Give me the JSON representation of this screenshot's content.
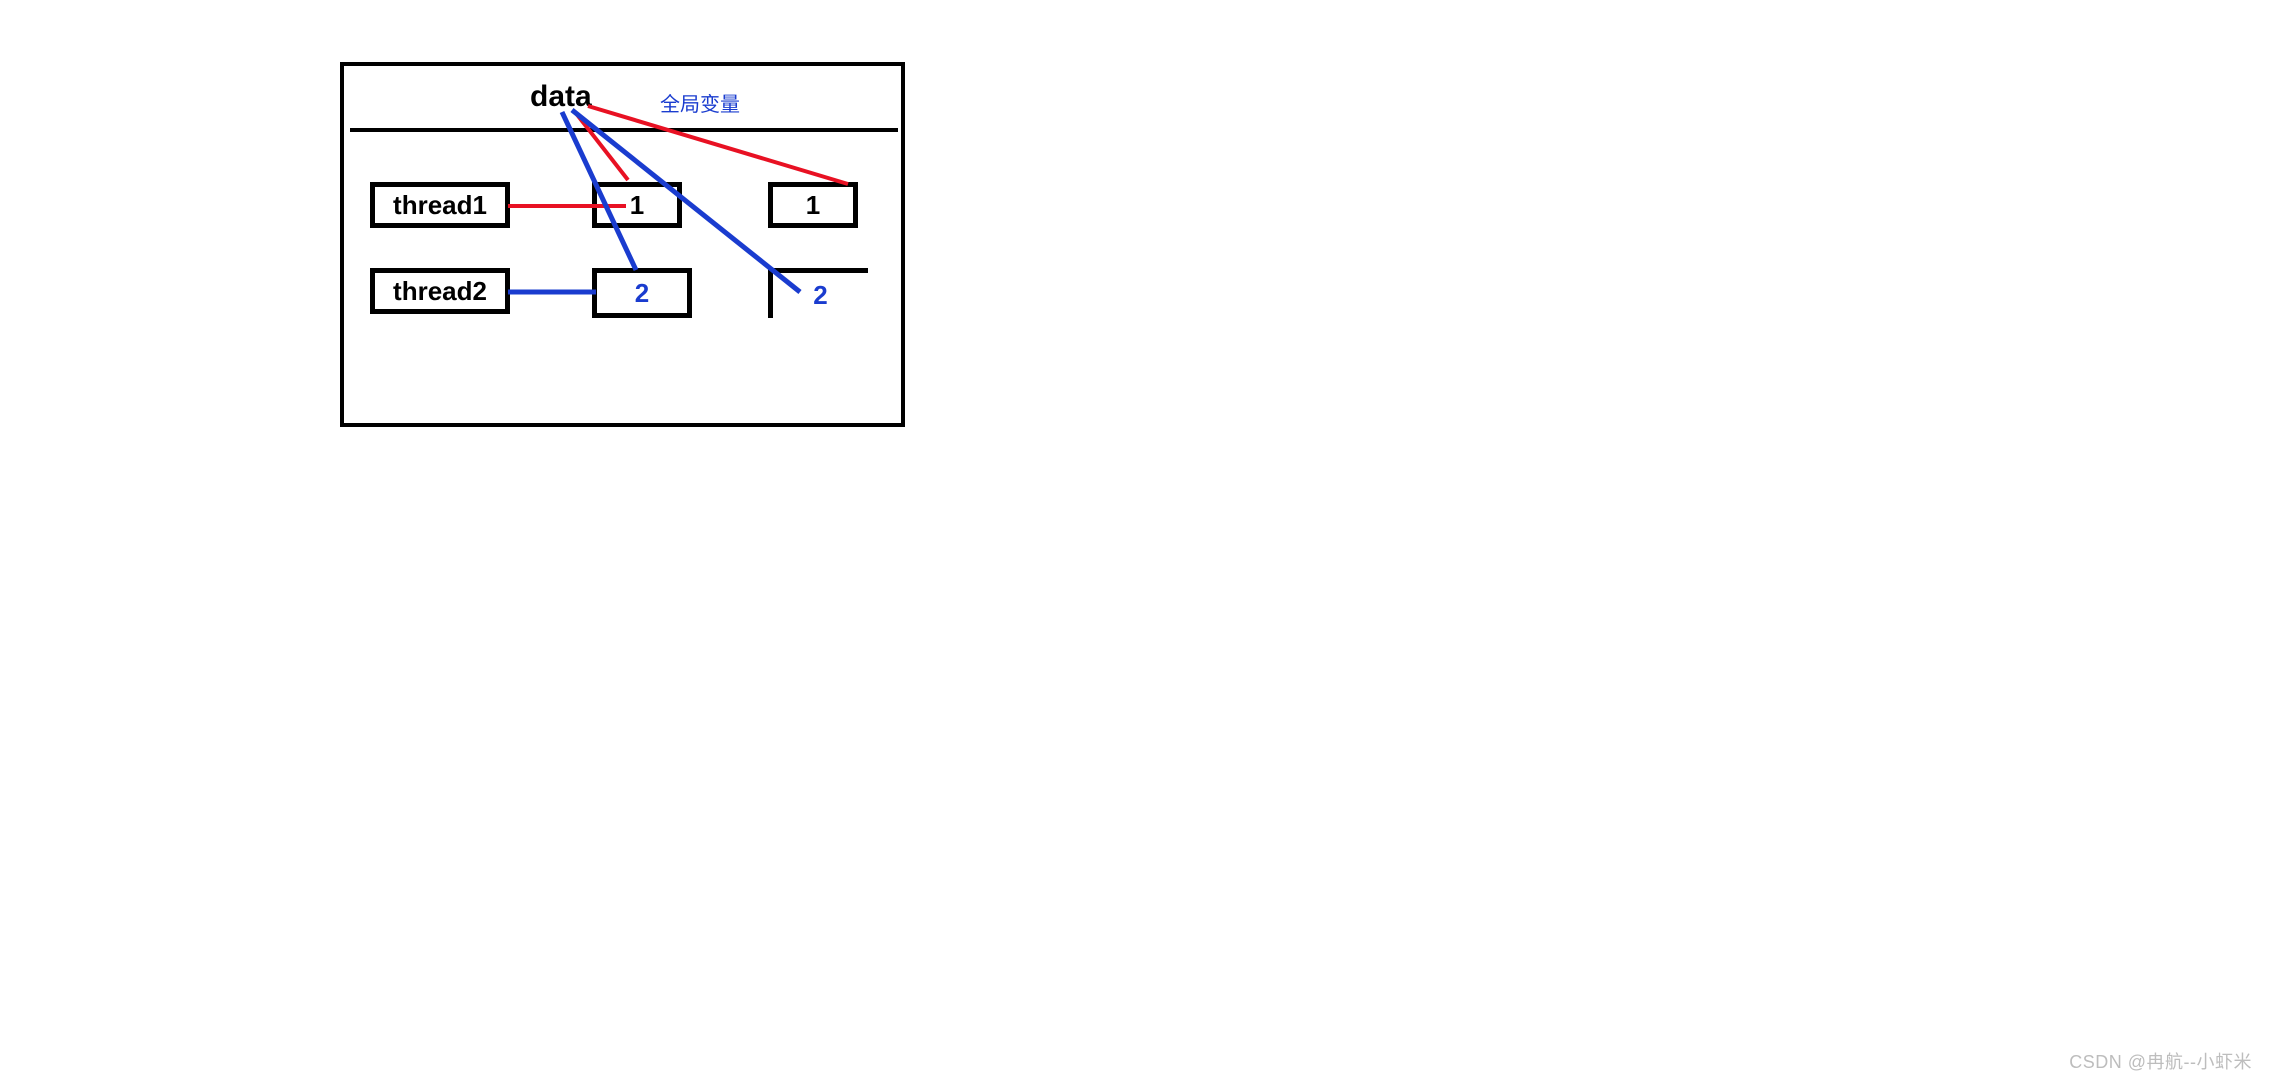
{
  "diagram": {
    "data_label": "data",
    "global_annotation": "全局变量",
    "thread1": {
      "name": "thread1",
      "val_a": "1",
      "val_b": "1"
    },
    "thread2": {
      "name": "thread2",
      "val_a": "2",
      "val_b": "2"
    }
  },
  "colors": {
    "red": "#e81123",
    "blue": "#1a3ccf",
    "black": "#000000"
  },
  "watermark": "CSDN @冉航--小虾米"
}
